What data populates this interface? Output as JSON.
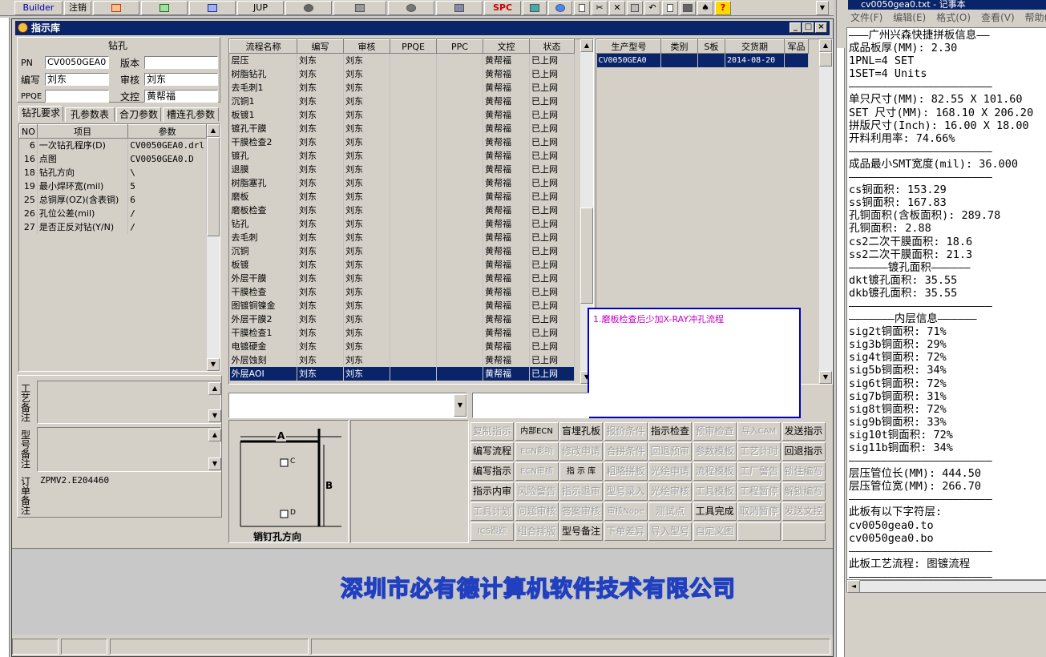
{
  "toolbar": {
    "builder": "Builder",
    "logout": "注销",
    "jup": "JUP",
    "spc": "SPC"
  },
  "window": {
    "title": "指示库"
  },
  "drill": {
    "section_title": "钻孔",
    "pn_label": "PN",
    "pn_value": "CV0050GEA0",
    "version_label": "版本",
    "version_value": "",
    "author_label": "编写",
    "author_value": "刘东",
    "reviewer_label": "审核",
    "reviewer_value": "刘东",
    "ppqe_label": "PPQE",
    "ppqe_value": "",
    "doc_label": "文控",
    "doc_value": "黄帮福"
  },
  "left_tabs": [
    "钻孔要求",
    "孔参数表",
    "合刀参数",
    "槽连孔参数"
  ],
  "params_table": {
    "headers": [
      "NO",
      "项目",
      "参数"
    ],
    "rows": [
      [
        "6",
        "一次钻孔程序(D)",
        "CV0050GEA0.drl"
      ],
      [
        "16",
        "点图",
        "CV0050GEA0.D"
      ],
      [
        "18",
        "钻孔方向",
        "\\"
      ],
      [
        "19",
        "最小焊环宽(mil)",
        "5"
      ],
      [
        "25",
        "总铜厚(OZ)(含表铜)",
        "6"
      ],
      [
        "26",
        "孔位公差(mil)",
        "/"
      ],
      [
        "27",
        "是否正反对钻(Y/N)",
        "/"
      ]
    ]
  },
  "notes": {
    "craft_label": "工艺备注",
    "model_label": "型号备注",
    "order_label": "订单备注",
    "order_value": "ZPMV2.E204460"
  },
  "process_table": {
    "headers": [
      "流程名称",
      "编写",
      "审核",
      "PPQE",
      "PPC",
      "文控",
      "状态"
    ],
    "rows": [
      [
        "层压",
        "刘东",
        "刘东",
        "",
        "",
        "黄帮福",
        "已上网"
      ],
      [
        "树脂钻孔",
        "刘东",
        "刘东",
        "",
        "",
        "黄帮福",
        "已上网"
      ],
      [
        "去毛刺1",
        "刘东",
        "刘东",
        "",
        "",
        "黄帮福",
        "已上网"
      ],
      [
        "沉铜1",
        "刘东",
        "刘东",
        "",
        "",
        "黄帮福",
        "已上网"
      ],
      [
        "板镀1",
        "刘东",
        "刘东",
        "",
        "",
        "黄帮福",
        "已上网"
      ],
      [
        "镀孔干膜",
        "刘东",
        "刘东",
        "",
        "",
        "黄帮福",
        "已上网"
      ],
      [
        "干膜检查2",
        "刘东",
        "刘东",
        "",
        "",
        "黄帮福",
        "已上网"
      ],
      [
        "镀孔",
        "刘东",
        "刘东",
        "",
        "",
        "黄帮福",
        "已上网"
      ],
      [
        "退膜",
        "刘东",
        "刘东",
        "",
        "",
        "黄帮福",
        "已上网"
      ],
      [
        "树脂塞孔",
        "刘东",
        "刘东",
        "",
        "",
        "黄帮福",
        "已上网"
      ],
      [
        "磨板",
        "刘东",
        "刘东",
        "",
        "",
        "黄帮福",
        "已上网"
      ],
      [
        "磨板检查",
        "刘东",
        "刘东",
        "",
        "",
        "黄帮福",
        "已上网"
      ],
      [
        "钻孔",
        "刘东",
        "刘东",
        "",
        "",
        "黄帮福",
        "已上网"
      ],
      [
        "去毛刺",
        "刘东",
        "刘东",
        "",
        "",
        "黄帮福",
        "已上网"
      ],
      [
        "沉铜",
        "刘东",
        "刘东",
        "",
        "",
        "黄帮福",
        "已上网"
      ],
      [
        "板镀",
        "刘东",
        "刘东",
        "",
        "",
        "黄帮福",
        "已上网"
      ],
      [
        "外层干膜",
        "刘东",
        "刘东",
        "",
        "",
        "黄帮福",
        "已上网"
      ],
      [
        "干膜检查",
        "刘东",
        "刘东",
        "",
        "",
        "黄帮福",
        "已上网"
      ],
      [
        "图镀铜镍金",
        "刘东",
        "刘东",
        "",
        "",
        "黄帮福",
        "已上网"
      ],
      [
        "外层干膜2",
        "刘东",
        "刘东",
        "",
        "",
        "黄帮福",
        "已上网"
      ],
      [
        "干膜检查1",
        "刘东",
        "刘东",
        "",
        "",
        "黄帮福",
        "已上网"
      ],
      [
        "电镀硬金",
        "刘东",
        "刘东",
        "",
        "",
        "黄帮福",
        "已上网"
      ],
      [
        "外层蚀刻",
        "刘东",
        "刘东",
        "",
        "",
        "黄帮福",
        "已上网"
      ],
      [
        "外层AOI",
        "刘东",
        "刘东",
        "",
        "",
        "黄帮福",
        "已上网"
      ]
    ]
  },
  "model_table": {
    "headers": [
      "生产型号",
      "类别",
      "S板",
      "交货期",
      "军品"
    ],
    "rows": [
      [
        "CV0050GEA0",
        "",
        "",
        "2014-08-20",
        ""
      ]
    ]
  },
  "popup_note": "1.磨板检查后少加X-RAY冲孔流程",
  "diagram": {
    "label_a": "A",
    "label_b": "B",
    "label_c": "C",
    "label_d": "D",
    "caption": "销钉孔方向"
  },
  "action_buttons": [
    [
      "复制指示",
      "内部ECN",
      "盲埋孔板",
      "报价条件",
      "指示检查",
      "预审检查",
      "导入CAM",
      "发送指示"
    ],
    [
      "编写流程",
      "ECN影响",
      "修改申请",
      "合拼条件",
      "回退预审",
      "参数模板",
      "工艺计时",
      "回退指示"
    ],
    [
      "编写指示",
      "ECN审核",
      "指 示 库",
      "粗略拼板",
      "光绘申请",
      "流程模板",
      "工厂警告",
      "锁住编写"
    ],
    [
      "指示内审",
      "风险警告",
      "指示退审",
      "型号录入",
      "光绘审核",
      "工具模板",
      "工程暂停",
      "解锁编写"
    ],
    [
      "工具计划",
      "问题审核",
      "答案审核",
      "审核Nope",
      "测试点",
      "工具完成",
      "取消暂停",
      "发送文控"
    ],
    [
      "ICS跟踪",
      "组合排版",
      "型号备注",
      "下单差异",
      "导入型号",
      "自定义图",
      "",
      ""
    ]
  ],
  "action_enabled": [
    [
      false,
      true,
      true,
      false,
      true,
      false,
      false,
      true
    ],
    [
      true,
      false,
      false,
      false,
      false,
      false,
      false,
      true
    ],
    [
      true,
      false,
      true,
      false,
      false,
      false,
      false,
      false
    ],
    [
      true,
      false,
      false,
      false,
      false,
      false,
      false,
      false
    ],
    [
      false,
      false,
      false,
      false,
      false,
      true,
      false,
      false
    ],
    [
      false,
      false,
      true,
      false,
      false,
      false,
      false,
      false
    ]
  ],
  "company_banner": "深圳市必有德计算机软件技术有限公司",
  "notepad": {
    "title": "cv0050gea0.txt - 记事本",
    "menu": [
      "文件(F)",
      "编辑(E)",
      "格式(O)",
      "查看(V)",
      "帮助(H)"
    ],
    "lines": [
      "———广州兴森快捷拼板信息——",
      "成品板厚(MM): 2.30",
      "1PNL=4 SET",
      "1SET=4 Units",
      "——————————————————————",
      "单只尺寸(MM): 82.55 X 101.60",
      "SET 尺寸(MM): 168.10 X 206.20",
      "拼版尺寸(Inch): 16.00 X 18.00",
      "开料利用率: 74.66%",
      "——————————————————————",
      "成品最小SMT宽度(mil): 36.000",
      "——————————————————————",
      "cs铜面积: 153.29",
      "ss铜面积: 167.83",
      "孔铜面积(含板面积): 289.78",
      "孔铜面积: 2.88",
      "cs2二次干膜面积: 18.6",
      "ss2二次干膜面积: 21.3",
      "——————镀孔面积——————",
      "dkt镀孔面积: 35.55",
      "dkb镀孔面积: 35.55",
      "——————————————————————",
      "———————内层信息——————",
      "sig2t铜面积: 71%",
      "sig3b铜面积: 29%",
      "sig4t铜面积: 72%",
      "sig5b铜面积: 34%",
      "sig6t铜面积: 72%",
      "sig7b铜面积: 31%",
      "sig8t铜面积: 72%",
      "sig9b铜面积: 33%",
      "sig10t铜面积: 72%",
      "sig11b铜面积: 34%",
      "——————————————————————",
      "层压管位长(MM): 444.50",
      "层压管位宽(MM): 266.70",
      "——————————————————————",
      "此板有以下字符层:",
      "cv0050gea0.to",
      "cv0050gea0.bo",
      "——————————————————————",
      "此板工艺流程: 图镀流程",
      "——————————————————————"
    ]
  },
  "colors": {
    "title_bar": "#0a246a",
    "selection": "#0a246a",
    "popup_border": "#0000c0",
    "popup_text": "#c000c0",
    "banner_fill": "#e8e8ff",
    "banner_stroke": "#2040c0"
  }
}
